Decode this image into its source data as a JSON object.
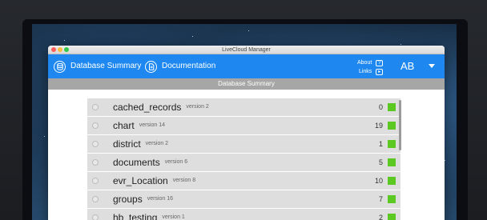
{
  "window": {
    "title": "LiveCloud Manager"
  },
  "appbar": {
    "nav": [
      {
        "label": "Database Summary",
        "icon": "database-icon"
      },
      {
        "label": "Documentation",
        "icon": "document-icon"
      }
    ],
    "about_label": "About",
    "about_icon_glyph": "?",
    "links_label": "Links",
    "links_icon_glyph": "▸",
    "avatar_initials": "AB"
  },
  "section": {
    "title": "Database Summary"
  },
  "tables": [
    {
      "name": "cached_records",
      "version": "version 2",
      "count": "0"
    },
    {
      "name": "chart",
      "version": "version 14",
      "count": "19"
    },
    {
      "name": "district",
      "version": "version 2",
      "count": "1"
    },
    {
      "name": "documents",
      "version": "version 6",
      "count": "5"
    },
    {
      "name": "evr_Location",
      "version": "version 8",
      "count": "10"
    },
    {
      "name": "groups",
      "version": "version 16",
      "count": "7"
    },
    {
      "name": "hb_testing",
      "version": "version 1",
      "count": "2"
    }
  ],
  "colors": {
    "accent": "#1e88f0",
    "header_bar": "#a6a6a6",
    "status_ok": "#5cc923",
    "row_bg": "#dedede"
  }
}
